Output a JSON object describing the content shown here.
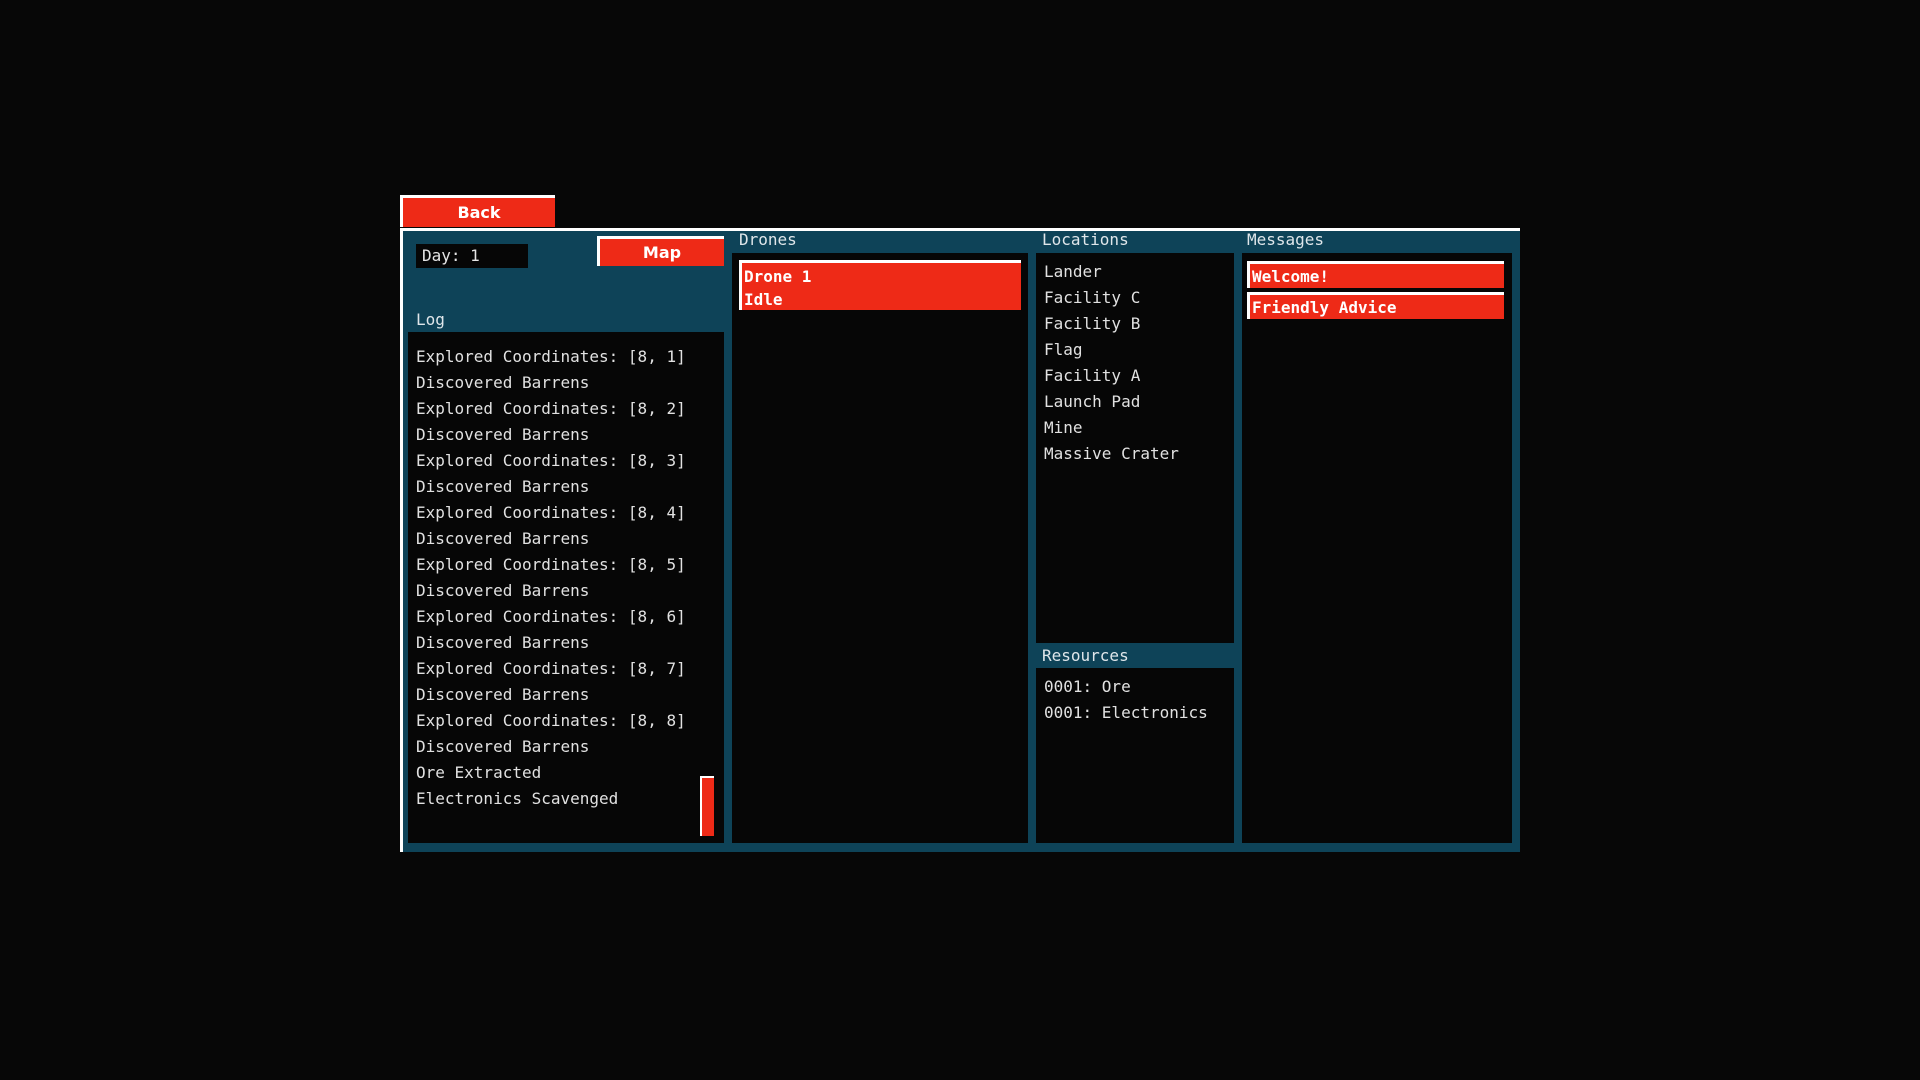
{
  "buttons": {
    "back": "Back",
    "map": "Map"
  },
  "status": {
    "day": "Day: 1"
  },
  "log": {
    "title": "Log",
    "entries": [
      "Explored Coordinates: [8, 1]",
      "Discovered Barrens",
      "Explored Coordinates: [8, 2]",
      "Discovered Barrens",
      "Explored Coordinates: [8, 3]",
      "Discovered Barrens",
      "Explored Coordinates: [8, 4]",
      "Discovered Barrens",
      "Explored Coordinates: [8, 5]",
      "Discovered Barrens",
      "Explored Coordinates: [8, 6]",
      "Discovered Barrens",
      "Explored Coordinates: [8, 7]",
      "Discovered Barrens",
      "Explored Coordinates: [8, 8]",
      "Discovered Barrens",
      "Ore Extracted",
      "Electronics Scavenged"
    ]
  },
  "drones": {
    "title": "Drones",
    "items": [
      {
        "name": "Drone 1",
        "status": "Idle"
      }
    ]
  },
  "locations": {
    "title": "Locations",
    "items": [
      "Lander",
      "Facility C",
      "Facility B",
      "Flag",
      "Facility A",
      "Launch Pad",
      "Mine",
      "Massive Crater"
    ]
  },
  "resources": {
    "title": "Resources",
    "items": [
      "0001: Ore",
      "0001: Electronics"
    ]
  },
  "messages": {
    "title": "Messages",
    "items": [
      "Welcome!",
      "Friendly Advice"
    ]
  },
  "colors": {
    "background": "#070707",
    "frame": "#0e4358",
    "accent_red": "#ee2a17",
    "panel": "#060606",
    "text": "#e1e1e1"
  }
}
